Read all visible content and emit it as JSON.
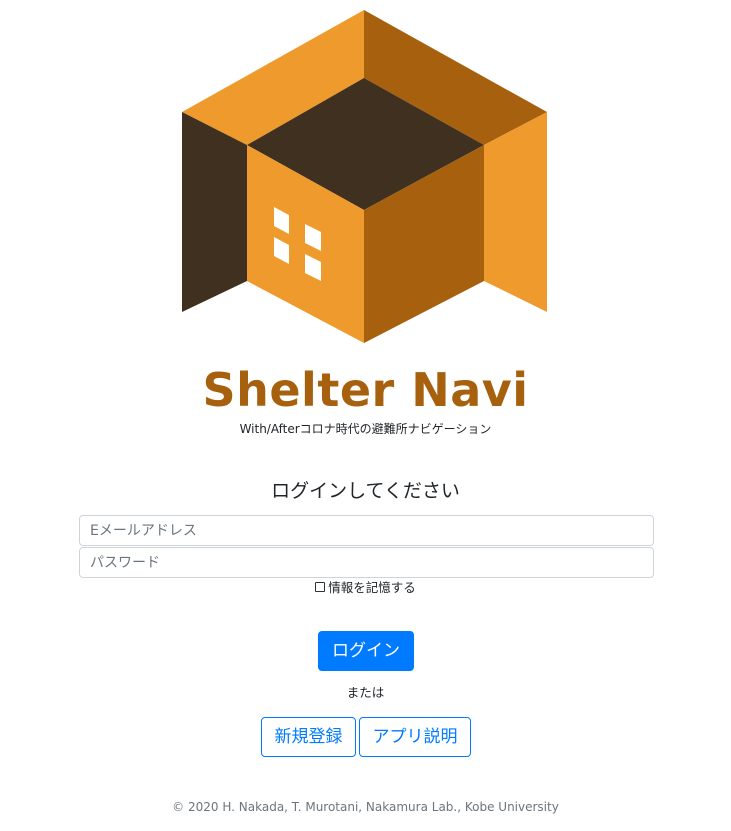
{
  "brand": {
    "name": "Shelter Navi",
    "tagline": "With/Afterコロナ時代の避難所ナビゲーション",
    "colors": {
      "light_orange": "#ee9a2d",
      "dark_orange": "#a6600e",
      "dark_brown": "#40301f",
      "window": "#ffffff"
    }
  },
  "login": {
    "heading": "ログインしてください",
    "email_placeholder": "Eメールアドレス",
    "password_placeholder": "パスワード",
    "remember_label": "情報を記憶する",
    "submit_label": "ログイン",
    "or_label": "または"
  },
  "actions": {
    "register_label": "新規登録",
    "about_label": "アプリ説明"
  },
  "footer": {
    "copyright": "© 2020 H. Nakada, T. Murotani, Nakamura Lab., Kobe University"
  },
  "theme": {
    "primary": "#007bff"
  }
}
